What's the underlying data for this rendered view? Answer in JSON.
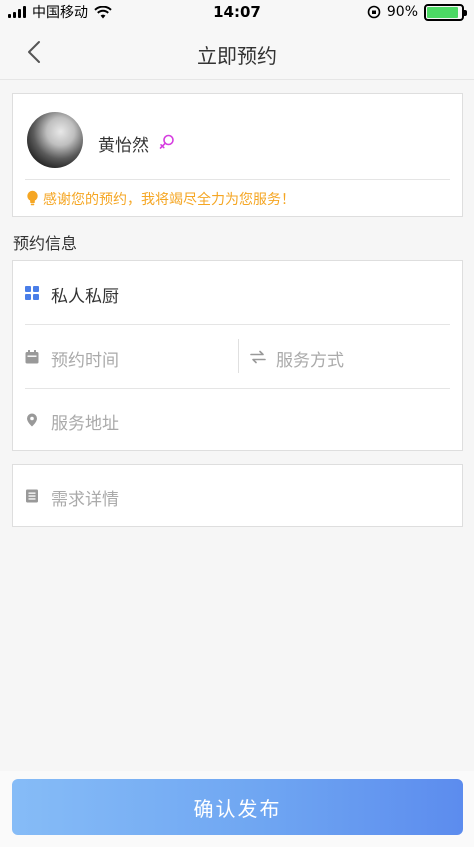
{
  "status_bar": {
    "carrier": "中国移动",
    "time": "14:07",
    "battery": "90%"
  },
  "nav": {
    "title": "立即预约",
    "back_icon": "chevron-left-icon"
  },
  "profile": {
    "name": "黄怡然",
    "gender_icon": "female-icon",
    "tip": "感谢您的预约，我将竭尽全力为您服务！"
  },
  "section": {
    "title": "预约信息"
  },
  "form": {
    "service_type": "私人私厨",
    "time_placeholder": "预约时间",
    "method_placeholder": "服务方式",
    "address_placeholder": "服务地址",
    "details_placeholder": "需求详情"
  },
  "footer": {
    "confirm_label": "确认发布"
  },
  "colors": {
    "accent": "#5c8cee",
    "tip": "#f5a623",
    "gender": "#d63ee0"
  }
}
